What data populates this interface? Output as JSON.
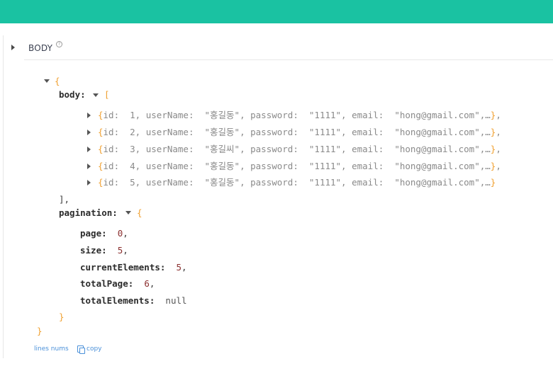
{
  "section": {
    "label": "BODY",
    "help_glyph": "?"
  },
  "json_view": {
    "root_open": "{",
    "root_close": "}",
    "body_key": "body:",
    "body_open": "[",
    "body_close": "],",
    "rows": [
      "{id:  1, userName:  \"홍길동\", password:  \"1111\", email:  \"hong@gmail.com\",…},",
      "{id:  2, userName:  \"홍길동\", password:  \"1111\", email:  \"hong@gmail.com\",…},",
      "{id:  3, userName:  \"홍길씨\", password:  \"1111\", email:  \"hong@gmail.com\",…},",
      "{id:  4, userName:  \"홍길동\", password:  \"1111\", email:  \"hong@gmail.com\",…},",
      "{id:  5, userName:  \"홍길동\", password:  \"1111\", email:  \"hong@gmail.com\",…}"
    ],
    "pagination_key": "pagination:",
    "pagination_open": "{",
    "pagination_close": "}",
    "pagination_fields": [
      {
        "key": "page:",
        "value": "0",
        "sep": ","
      },
      {
        "key": "size:",
        "value": "5",
        "sep": ","
      },
      {
        "key": "currentElements:",
        "value": "5",
        "sep": ","
      },
      {
        "key": "totalPage:",
        "value": "6",
        "sep": ","
      },
      {
        "key": "totalElements:",
        "value": "null",
        "sep": ""
      }
    ]
  },
  "footer": {
    "lines_nums": "lines nums",
    "copy": "copy"
  },
  "colors": {
    "topbar": "#1ac2a2",
    "brace": "#f0a030",
    "number": "#8b2f2f",
    "link": "#4a90d9"
  }
}
